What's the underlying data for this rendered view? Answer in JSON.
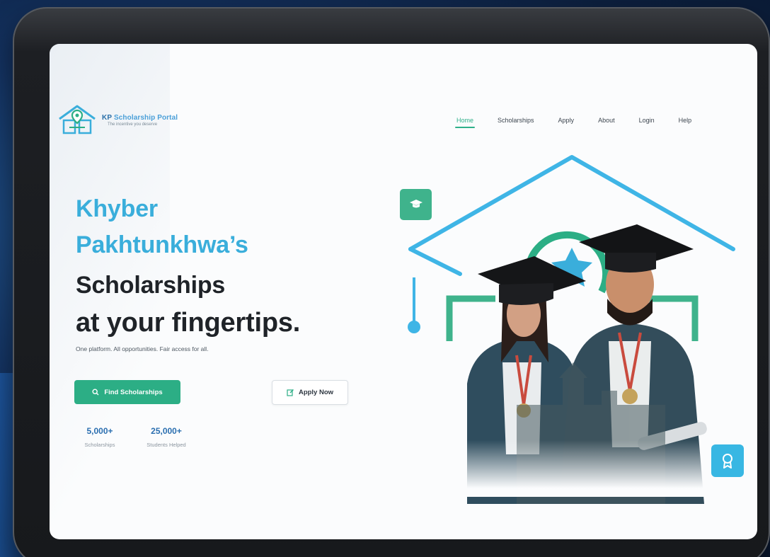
{
  "brand": {
    "name_prefix": "KP",
    "name_rest": "Scholarship Portal",
    "tagline": "The incentive you deserve",
    "logo_icon": "house-location-pin-icon"
  },
  "nav": {
    "items": [
      "Home",
      "Scholarships",
      "Apply",
      "About",
      "Login",
      "Help"
    ],
    "active": "Home"
  },
  "hero": {
    "line1": "Khyber",
    "line2": "Pakhtunkhwa’s",
    "line3": "Scholarships",
    "line4": "at your fingertips.",
    "subtitle": "One platform. All opportunities. Fair access for all."
  },
  "buttons": {
    "find": "Find Scholarships",
    "find_icon": "search-icon",
    "apply": "Apply Now",
    "apply_icon": "edit-icon"
  },
  "stats": [
    {
      "value": "5,000+",
      "label": "Scholarships"
    },
    {
      "value": "25,000+",
      "label": "Students Helped"
    }
  ],
  "colors": {
    "accent_green": "#2cae85",
    "accent_blue": "#3aaedb",
    "heading_dark": "#1f2328",
    "stat_blue": "#2b6fb0"
  },
  "illustration": {
    "badge_left_icon": "graduation-cap-icon",
    "badge_right_icon": "award-icon",
    "center_icon": "star-icon"
  }
}
